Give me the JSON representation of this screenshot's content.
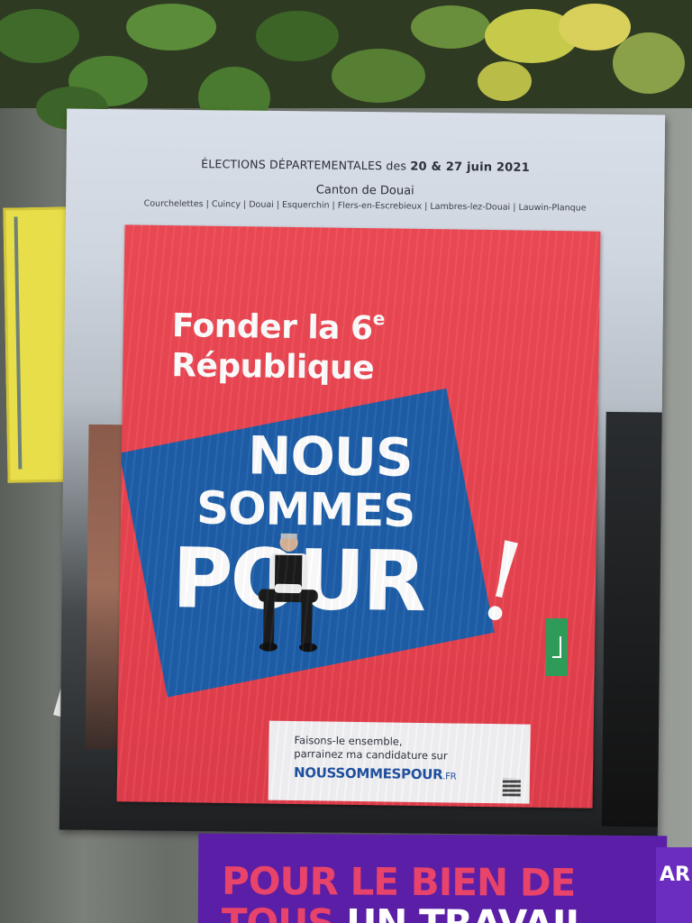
{
  "back_poster": {
    "election_prefix": "ÉLECTIONS DÉPARTEMENTALES des",
    "election_dates": "20 & 27 juin 2021",
    "canton": "Canton de Douai",
    "towns": "Courchelettes | Cuincy | Douai | Esquerchin | Flers-en-Escrebieux | Lambres-lez-Douai | Lauwin-Planque"
  },
  "main_poster": {
    "slogan_line1": "Fonder la 6",
    "slogan_sup": "e",
    "slogan_line2": "République",
    "headline_line1": "NOUS",
    "headline_line2": "SOMMES",
    "headline_line3": "POUR",
    "exclamation": "!",
    "cta_line1": "Faisons-le ensemble,",
    "cta_line2": "parrainez ma candidature sur",
    "cta_url": "NOUSSOMMESPOUR",
    "cta_tld": ".FR",
    "colors": {
      "background": "#e9434f",
      "box": "#1e5fa9",
      "text": "#ffffff",
      "url": "#1e4fa0"
    }
  },
  "bottom_poster": {
    "line1": "POUR LE BIEN DE",
    "line2_pink": "TOUS",
    "line2_white": "UN TRAVAIL",
    "side_text": "AR",
    "colors": {
      "background": "#5b1ea6",
      "accent": "#e8436a"
    }
  }
}
